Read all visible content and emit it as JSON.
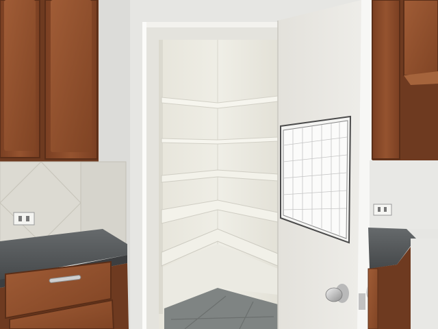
{
  "scene": {
    "kind": "photo",
    "subject": "walk-in pantry",
    "colors": {
      "wall": "#e6e6e3",
      "cabinet_wood": "#8a4a2a",
      "cabinet_dark": "#6e3a20",
      "granite": "#55585a",
      "pantry_interior": "#ecebe4",
      "shelf": "#f3f2ea",
      "door": "#eceae4",
      "floor_tile": "#7f8483",
      "calendar_frame": "#4a4a4a"
    },
    "objects": [
      {
        "name": "upper-cabinet-left",
        "interactable": false
      },
      {
        "name": "upper-cabinet-right",
        "interactable": false
      },
      {
        "name": "tile-backsplash",
        "interactable": false
      },
      {
        "name": "granite-countertop-left",
        "interactable": false
      },
      {
        "name": "granite-countertop-right",
        "interactable": false
      },
      {
        "name": "lower-cabinet-left",
        "interactable": false
      },
      {
        "name": "lower-cabinet-right",
        "interactable": false
      },
      {
        "name": "drawer-handle",
        "interactable": true
      },
      {
        "name": "pantry-doorframe",
        "interactable": false
      },
      {
        "name": "pantry-shelves",
        "interactable": false
      },
      {
        "name": "pantry-floor",
        "interactable": false
      },
      {
        "name": "pantry-door",
        "interactable": true
      },
      {
        "name": "dry-erase-calendar",
        "interactable": false
      },
      {
        "name": "door-knob",
        "interactable": true
      },
      {
        "name": "wall-outlet",
        "interactable": false
      }
    ]
  }
}
